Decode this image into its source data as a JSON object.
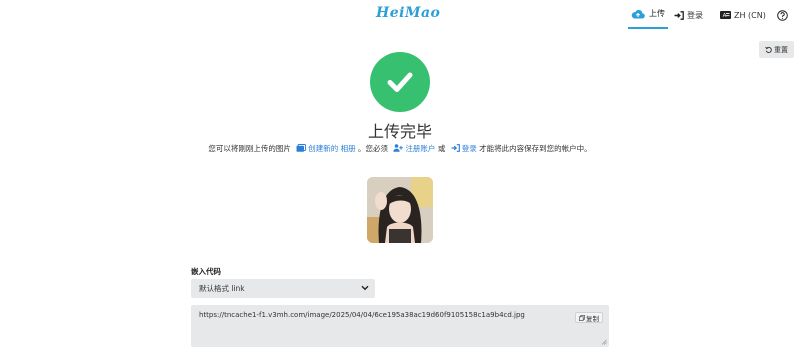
{
  "header": {
    "logo": "HeiMao",
    "nav": {
      "upload": "上传",
      "login": "登录",
      "language": "ZH (CN)"
    }
  },
  "toolbar": {
    "reset_label": "重置"
  },
  "main": {
    "title": "上传完毕",
    "subtitle": {
      "part1": "您可以将刚刚上传的图片",
      "create_album": "创建新的 相册",
      "part2": "。您必须",
      "register": "注册账户",
      "part3": "或",
      "login": "登录",
      "part4": "才能将此内容保存到您的帐户中。"
    }
  },
  "embed": {
    "label": "嵌入代码",
    "format_selected": "默认格式 link",
    "code": "https://tncache1-f1.v3mh.com/image/2025/04/04/6ce195a38ac19d60f9105158c1a9b4cd.jpg",
    "copy_label": "复制"
  },
  "colors": {
    "accent": "#2c9fd8",
    "success": "#36c070"
  }
}
